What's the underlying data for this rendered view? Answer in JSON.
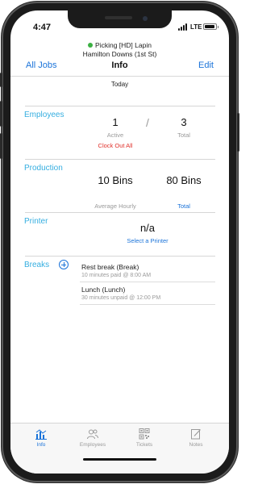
{
  "status_bar": {
    "time": "4:47",
    "network": "LTE",
    "battery_level": 0.9
  },
  "crumb": {
    "line1": "Picking [HD] Lapin",
    "line2": "Hamilton Downs (1st St)",
    "status_color": "#3cb043"
  },
  "nav": {
    "left": "All Jobs",
    "title": "Info",
    "right": "Edit"
  },
  "date_label": "Today",
  "employees": {
    "label": "Employees",
    "active_count": "1",
    "active_label": "Active",
    "separator": "/",
    "total_count": "3",
    "total_label": "Total",
    "clock_out_label": "Clock Out All"
  },
  "production": {
    "label": "Production",
    "hourly_value": "10 Bins",
    "hourly_label": "Average Hourly",
    "total_value": "80 Bins",
    "total_label": "Total"
  },
  "printer": {
    "label": "Printer",
    "value": "n/a",
    "select_label": "Select a Printer"
  },
  "breaks": {
    "label": "Breaks",
    "items": [
      {
        "title": "Rest break (Break)",
        "detail": "10 minutes paid @ 8:00 AM"
      },
      {
        "title": "Lunch (Lunch)",
        "detail": "30 minutes unpaid @ 12:00 PM"
      }
    ]
  },
  "tabs": [
    {
      "label": "Info",
      "icon": "info-chart-icon",
      "active": true
    },
    {
      "label": "Employees",
      "icon": "employees-icon",
      "active": false
    },
    {
      "label": "Tickets",
      "icon": "qr-code-icon",
      "active": false
    },
    {
      "label": "Notes",
      "icon": "notes-edit-icon",
      "active": false
    }
  ],
  "colors": {
    "accent": "#1a73d9",
    "section": "#35aee0",
    "danger": "#e0312b"
  }
}
